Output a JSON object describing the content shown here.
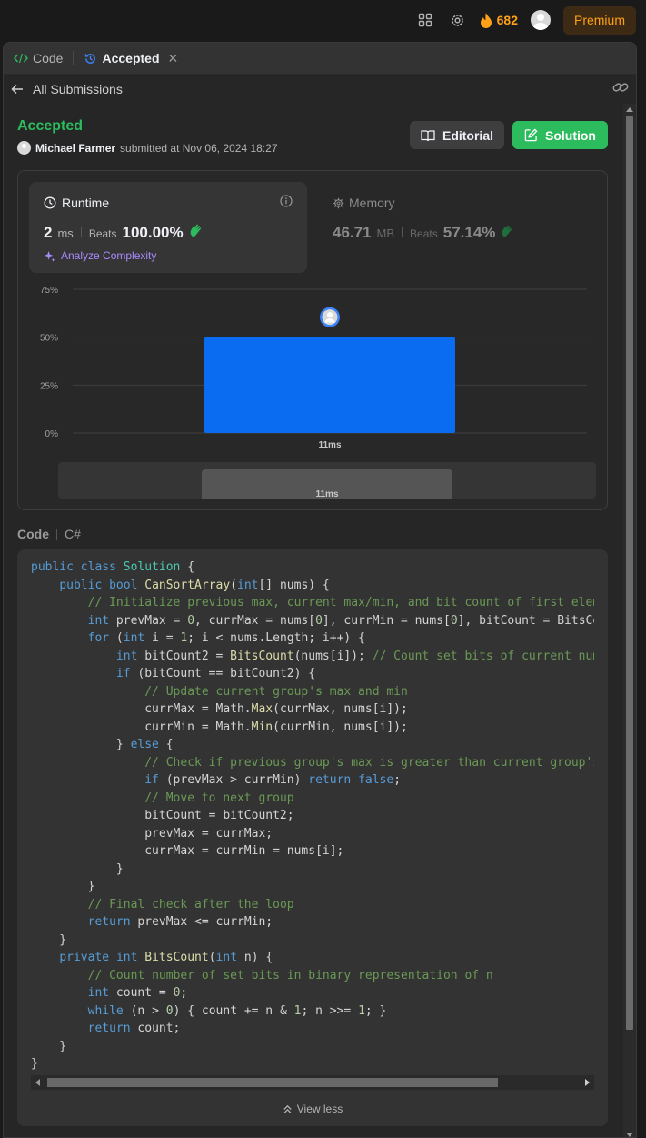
{
  "topbar": {
    "streak_count": "682",
    "premium_label": "Premium"
  },
  "tabs": {
    "code_label": "Code",
    "accepted_label": "Accepted",
    "close_glyph": "✕"
  },
  "subbar": {
    "back_label": "All Submissions"
  },
  "submission": {
    "status": "Accepted",
    "user": "Michael Farmer",
    "submitted_text": "submitted at Nov 06, 2024 18:27",
    "editorial_label": "Editorial",
    "solution_label": "Solution"
  },
  "runtime": {
    "title": "Runtime",
    "value": "2",
    "unit": "ms",
    "beats_label": "Beats",
    "beats_value": "100.00%",
    "analyze_label": "Analyze Complexity"
  },
  "memory": {
    "title": "Memory",
    "value": "46.71",
    "unit": "MB",
    "beats_label": "Beats",
    "beats_value": "57.14%"
  },
  "chart_data": {
    "type": "bar",
    "categories": [
      "11ms"
    ],
    "values": [
      50
    ],
    "ylim": [
      0,
      75
    ],
    "yticks": [
      "0%",
      "25%",
      "50%",
      "75%"
    ],
    "grid": true
  },
  "minimap": {
    "label": "11ms"
  },
  "code": {
    "label": "Code",
    "language": "C#",
    "view_less_label": "View less"
  },
  "colors": {
    "accepted_green": "#2cbb5d",
    "premium_orange": "#ffa116",
    "bar_blue": "#0a6cf0",
    "analyze_purple": "#a78bfa"
  }
}
